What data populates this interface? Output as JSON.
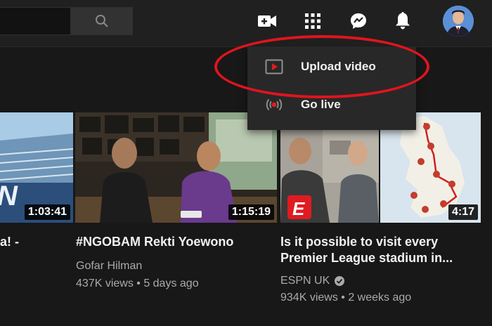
{
  "header": {
    "icons": [
      "search-icon",
      "create-video-icon",
      "apps-icon",
      "messages-icon",
      "notifications-icon"
    ]
  },
  "menu": {
    "items": [
      {
        "label": "Upload video",
        "icon": "upload-video-icon"
      },
      {
        "label": "Go live",
        "icon": "go-live-icon"
      }
    ]
  },
  "videos": [
    {
      "duration": "1:03:41",
      "title": "a! -",
      "channel": "",
      "views": ""
    },
    {
      "duration": "1:15:19",
      "title": "#NGOBAM Rekti Yoewono",
      "channel": "Gofar Hilman",
      "views": "437K views • 5 days ago"
    },
    {
      "duration": "4:17",
      "title_line1": "Is it possible to visit every",
      "title_line2": "Premier League stadium in...",
      "channel": "ESPN UK",
      "verified": true,
      "views": "934K views • 2 weeks ago"
    }
  ],
  "colors": {
    "accent_red": "#e0141e",
    "background": "#181818",
    "header": "#202020"
  }
}
